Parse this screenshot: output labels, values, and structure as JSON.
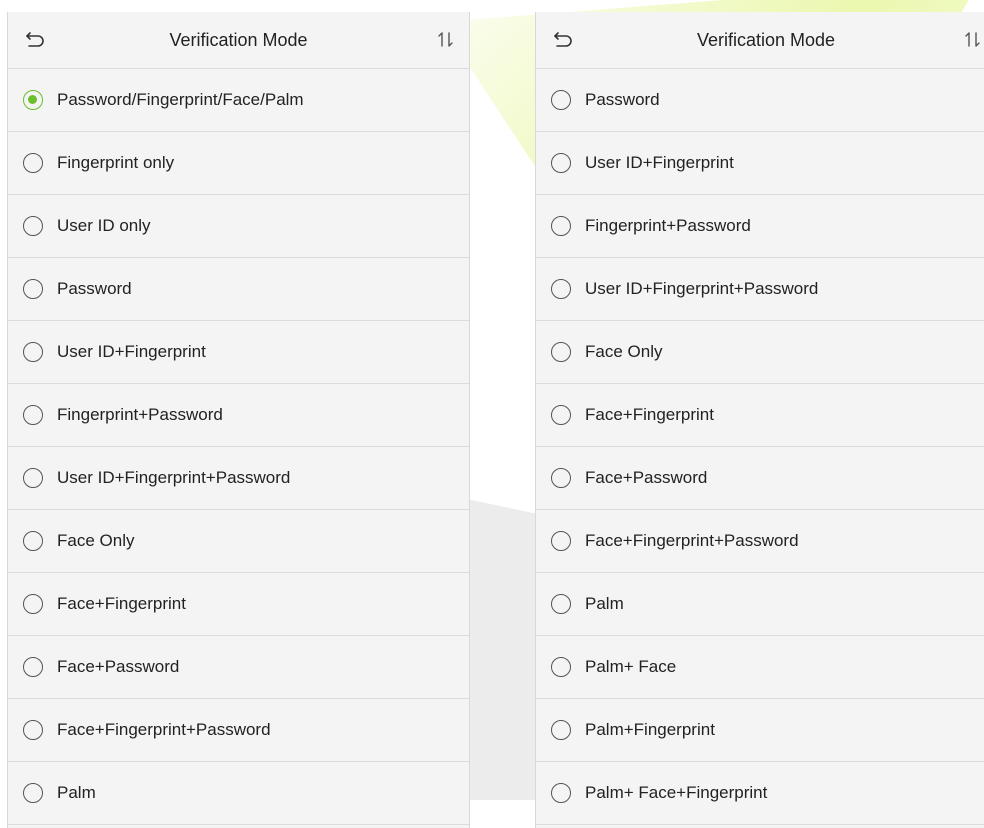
{
  "screens": [
    {
      "title": "Verification Mode",
      "icons": {
        "back": "back-arrow-icon",
        "sort": "sort-icon"
      },
      "options": [
        {
          "label": "Password/Fingerprint/Face/Palm",
          "selected": true
        },
        {
          "label": "Fingerprint only",
          "selected": false
        },
        {
          "label": "User ID only",
          "selected": false
        },
        {
          "label": "Password",
          "selected": false
        },
        {
          "label": "User ID+Fingerprint",
          "selected": false
        },
        {
          "label": "Fingerprint+Password",
          "selected": false
        },
        {
          "label": "User ID+Fingerprint+Password",
          "selected": false
        },
        {
          "label": "Face Only",
          "selected": false
        },
        {
          "label": "Face+Fingerprint",
          "selected": false
        },
        {
          "label": "Face+Password",
          "selected": false
        },
        {
          "label": "Face+Fingerprint+Password",
          "selected": false
        },
        {
          "label": "Palm",
          "selected": false
        }
      ]
    },
    {
      "title": "Verification Mode",
      "icons": {
        "back": "back-arrow-icon",
        "sort": "sort-icon"
      },
      "options": [
        {
          "label": "Password",
          "selected": false
        },
        {
          "label": "User ID+Fingerprint",
          "selected": false
        },
        {
          "label": "Fingerprint+Password",
          "selected": false
        },
        {
          "label": "User ID+Fingerprint+Password",
          "selected": false
        },
        {
          "label": "Face Only",
          "selected": false
        },
        {
          "label": "Face+Fingerprint",
          "selected": false
        },
        {
          "label": "Face+Password",
          "selected": false
        },
        {
          "label": "Face+Fingerprint+Password",
          "selected": false
        },
        {
          "label": "Palm",
          "selected": false
        },
        {
          "label": "Palm+ Face",
          "selected": false
        },
        {
          "label": "Palm+Fingerprint",
          "selected": false
        },
        {
          "label": "Palm+ Face+Fingerprint",
          "selected": false
        }
      ]
    }
  ],
  "colors": {
    "accent": "#6abf2a",
    "background": "#f4f4f4",
    "divider": "#dcdcdc",
    "text": "#222222"
  }
}
